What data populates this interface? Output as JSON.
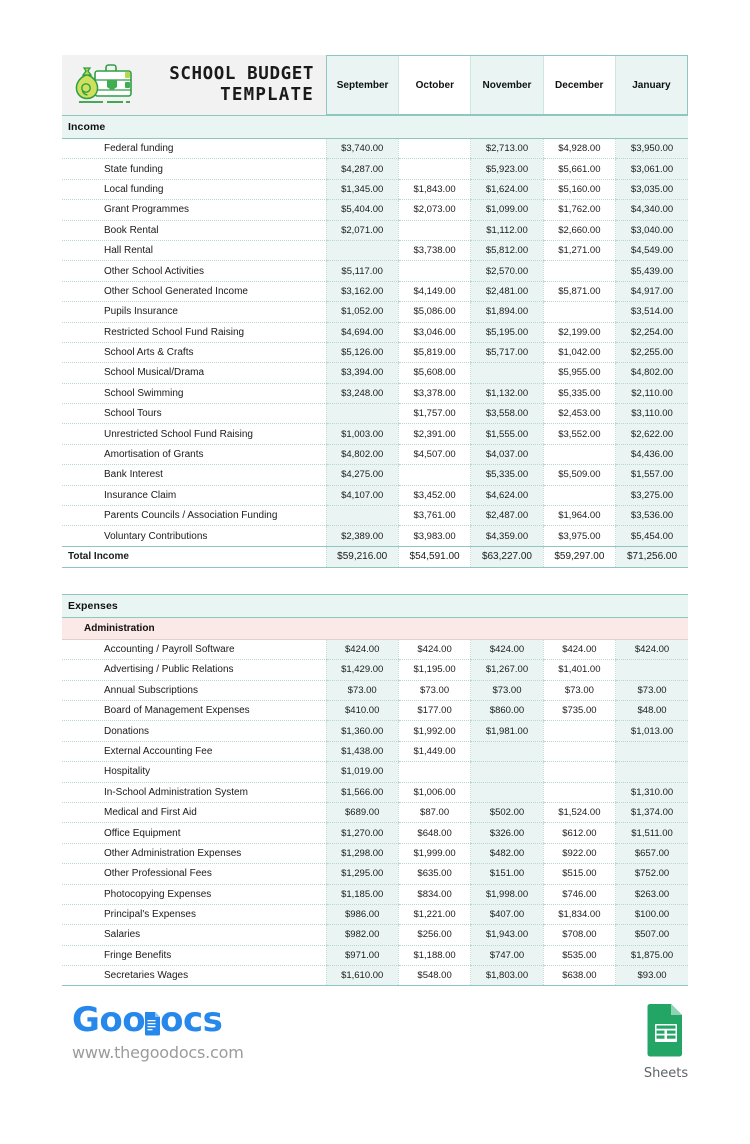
{
  "document": {
    "title_line1": "SCHOOL BUDGET",
    "title_line2": "TEMPLATE",
    "logo_icon": "money-bag-and-cash-register-icon"
  },
  "columns": [
    "September",
    "October",
    "November",
    "December",
    "January"
  ],
  "sections": [
    {
      "name": "Income",
      "rows": [
        {
          "label": "Federal funding",
          "values": [
            "$3,740.00",
            "",
            "$2,713.00",
            "$4,928.00",
            "$3,950.00"
          ]
        },
        {
          "label": "State funding",
          "values": [
            "$4,287.00",
            "",
            "$5,923.00",
            "$5,661.00",
            "$3,061.00"
          ]
        },
        {
          "label": "Local funding",
          "values": [
            "$1,345.00",
            "$1,843.00",
            "$1,624.00",
            "$5,160.00",
            "$3,035.00"
          ]
        },
        {
          "label": "Grant Programmes",
          "values": [
            "$5,404.00",
            "$2,073.00",
            "$1,099.00",
            "$1,762.00",
            "$4,340.00"
          ]
        },
        {
          "label": "Book Rental",
          "values": [
            "$2,071.00",
            "",
            "$1,112.00",
            "$2,660.00",
            "$3,040.00"
          ]
        },
        {
          "label": "Hall Rental",
          "values": [
            "",
            "$3,738.00",
            "$5,812.00",
            "$1,271.00",
            "$4,549.00"
          ]
        },
        {
          "label": "Other School Activities",
          "values": [
            "$5,117.00",
            "",
            "$2,570.00",
            "",
            "$5,439.00"
          ]
        },
        {
          "label": "Other School Generated Income",
          "values": [
            "$3,162.00",
            "$4,149.00",
            "$2,481.00",
            "$5,871.00",
            "$4,917.00"
          ]
        },
        {
          "label": "Pupils Insurance",
          "values": [
            "$1,052.00",
            "$5,086.00",
            "$1,894.00",
            "",
            "$3,514.00"
          ]
        },
        {
          "label": "Restricted School Fund Raising",
          "values": [
            "$4,694.00",
            "$3,046.00",
            "$5,195.00",
            "$2,199.00",
            "$2,254.00"
          ]
        },
        {
          "label": "School Arts & Crafts",
          "values": [
            "$5,126.00",
            "$5,819.00",
            "$5,717.00",
            "$1,042.00",
            "$2,255.00"
          ]
        },
        {
          "label": "School Musical/Drama",
          "values": [
            "$3,394.00",
            "$5,608.00",
            "",
            "$5,955.00",
            "$4,802.00"
          ]
        },
        {
          "label": "School Swimming",
          "values": [
            "$3,248.00",
            "$3,378.00",
            "$1,132.00",
            "$5,335.00",
            "$2,110.00"
          ]
        },
        {
          "label": "School Tours",
          "values": [
            "",
            "$1,757.00",
            "$3,558.00",
            "$2,453.00",
            "$3,110.00"
          ]
        },
        {
          "label": "Unrestricted School Fund Raising",
          "values": [
            "$1,003.00",
            "$2,391.00",
            "$1,555.00",
            "$3,552.00",
            "$2,622.00"
          ]
        },
        {
          "label": "Amortisation of Grants",
          "values": [
            "$4,802.00",
            "$4,507.00",
            "$4,037.00",
            "",
            "$4,436.00"
          ]
        },
        {
          "label": "Bank Interest",
          "values": [
            "$4,275.00",
            "",
            "$5,335.00",
            "$5,509.00",
            "$1,557.00"
          ]
        },
        {
          "label": "Insurance Claim",
          "values": [
            "$4,107.00",
            "$3,452.00",
            "$4,624.00",
            "",
            "$3,275.00"
          ]
        },
        {
          "label": "Parents Councils / Association Funding",
          "values": [
            "",
            "$3,761.00",
            "$2,487.00",
            "$1,964.00",
            "$3,536.00"
          ]
        },
        {
          "label": "Voluntary Contributions",
          "values": [
            "$2,389.00",
            "$3,983.00",
            "$4,359.00",
            "$3,975.00",
            "$5,454.00"
          ]
        }
      ],
      "total": {
        "label": "Total Income",
        "values": [
          "$59,216.00",
          "$54,591.00",
          "$63,227.00",
          "$59,297.00",
          "$71,256.00"
        ]
      }
    },
    {
      "name": "Expenses",
      "subsection": "Administration",
      "rows": [
        {
          "label": "Accounting / Payroll Software",
          "values": [
            "$424.00",
            "$424.00",
            "$424.00",
            "$424.00",
            "$424.00"
          ]
        },
        {
          "label": "Advertising / Public Relations",
          "values": [
            "$1,429.00",
            "$1,195.00",
            "$1,267.00",
            "$1,401.00",
            ""
          ]
        },
        {
          "label": "Annual Subscriptions",
          "values": [
            "$73.00",
            "$73.00",
            "$73.00",
            "$73.00",
            "$73.00"
          ]
        },
        {
          "label": "Board of Management Expenses",
          "values": [
            "$410.00",
            "$177.00",
            "$860.00",
            "$735.00",
            "$48.00"
          ]
        },
        {
          "label": "Donations",
          "values": [
            "$1,360.00",
            "$1,992.00",
            "$1,981.00",
            "",
            "$1,013.00"
          ]
        },
        {
          "label": "External Accounting Fee",
          "values": [
            "$1,438.00",
            "$1,449.00",
            "",
            "",
            ""
          ]
        },
        {
          "label": "Hospitality",
          "values": [
            "$1,019.00",
            "",
            "",
            "",
            ""
          ]
        },
        {
          "label": "In-School Administration System",
          "values": [
            "$1,566.00",
            "$1,006.00",
            "",
            "",
            "$1,310.00"
          ]
        },
        {
          "label": "Medical and First Aid",
          "values": [
            "$689.00",
            "$87.00",
            "$502.00",
            "$1,524.00",
            "$1,374.00"
          ]
        },
        {
          "label": "Office Equipment",
          "values": [
            "$1,270.00",
            "$648.00",
            "$326.00",
            "$612.00",
            "$1,511.00"
          ]
        },
        {
          "label": "Other Administration Expenses",
          "values": [
            "$1,298.00",
            "$1,999.00",
            "$482.00",
            "$922.00",
            "$657.00"
          ]
        },
        {
          "label": "Other Professional Fees",
          "values": [
            "$1,295.00",
            "$635.00",
            "$151.00",
            "$515.00",
            "$752.00"
          ]
        },
        {
          "label": "Photocopying Expenses",
          "values": [
            "$1,185.00",
            "$834.00",
            "$1,998.00",
            "$746.00",
            "$263.00"
          ]
        },
        {
          "label": "Principal's Expenses",
          "values": [
            "$986.00",
            "$1,221.00",
            "$407.00",
            "$1,834.00",
            "$100.00"
          ]
        },
        {
          "label": "Salaries",
          "values": [
            "$982.00",
            "$256.00",
            "$1,943.00",
            "$708.00",
            "$507.00"
          ]
        },
        {
          "label": "Fringe Benefits",
          "values": [
            "$971.00",
            "$1,188.00",
            "$747.00",
            "$535.00",
            "$1,875.00"
          ]
        },
        {
          "label": "Secretaries Wages",
          "values": [
            "$1,610.00",
            "$548.00",
            "$1,803.00",
            "$638.00",
            "$93.00"
          ]
        }
      ]
    }
  ],
  "footer": {
    "brand_part1": "Goo",
    "brand_part2": "ocs",
    "brand_icon": "document-page-icon",
    "url": "www.thegoodocs.com",
    "app_label": "Sheets",
    "app_icon": "google-sheets-icon"
  },
  "colors": {
    "accent_border": "#8fc7c0",
    "tint": "#e9f4f3",
    "section_bg": "#e9f5f3",
    "subsection_bg": "#fbe9e7",
    "brand_blue": "#2688eb",
    "sheets_green": "#23a566"
  }
}
